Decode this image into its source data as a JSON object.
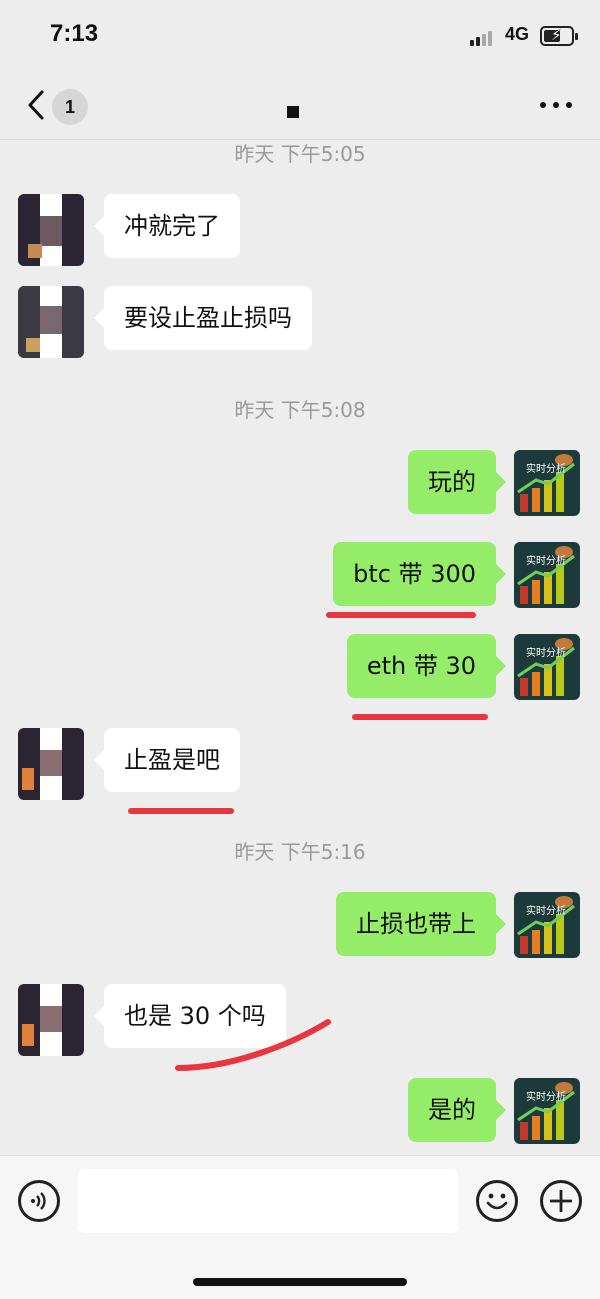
{
  "status_bar": {
    "time": "7:13",
    "network": "4G"
  },
  "nav": {
    "unread_count": "1",
    "title": "■"
  },
  "messages": [
    {
      "type": "timestamp",
      "text": "昨天 下午5:05"
    },
    {
      "type": "incoming",
      "text": "冲就完了"
    },
    {
      "type": "incoming",
      "text": "要设止盈止损吗"
    },
    {
      "type": "timestamp",
      "text": "昨天 下午5:08"
    },
    {
      "type": "outgoing",
      "text": "玩的"
    },
    {
      "type": "outgoing",
      "text": "btc 带 300"
    },
    {
      "type": "outgoing",
      "text": "eth 带 30"
    },
    {
      "type": "incoming",
      "text": "止盈是吧"
    },
    {
      "type": "timestamp",
      "text": "昨天 下午5:16"
    },
    {
      "type": "outgoing",
      "text": "止损也带上"
    },
    {
      "type": "incoming",
      "text": "也是 30 个吗"
    },
    {
      "type": "outgoing",
      "text": "是的"
    }
  ],
  "input": {
    "placeholder": ""
  },
  "colors": {
    "outgoing_bubble": "#95ec69",
    "incoming_bubble": "#ffffff",
    "annotation": "#e8353f",
    "background": "#ededed"
  },
  "icons": [
    "back-icon",
    "more-icon",
    "voice-icon",
    "emoji-icon",
    "plus-icon",
    "signal-icon",
    "battery-icon"
  ]
}
